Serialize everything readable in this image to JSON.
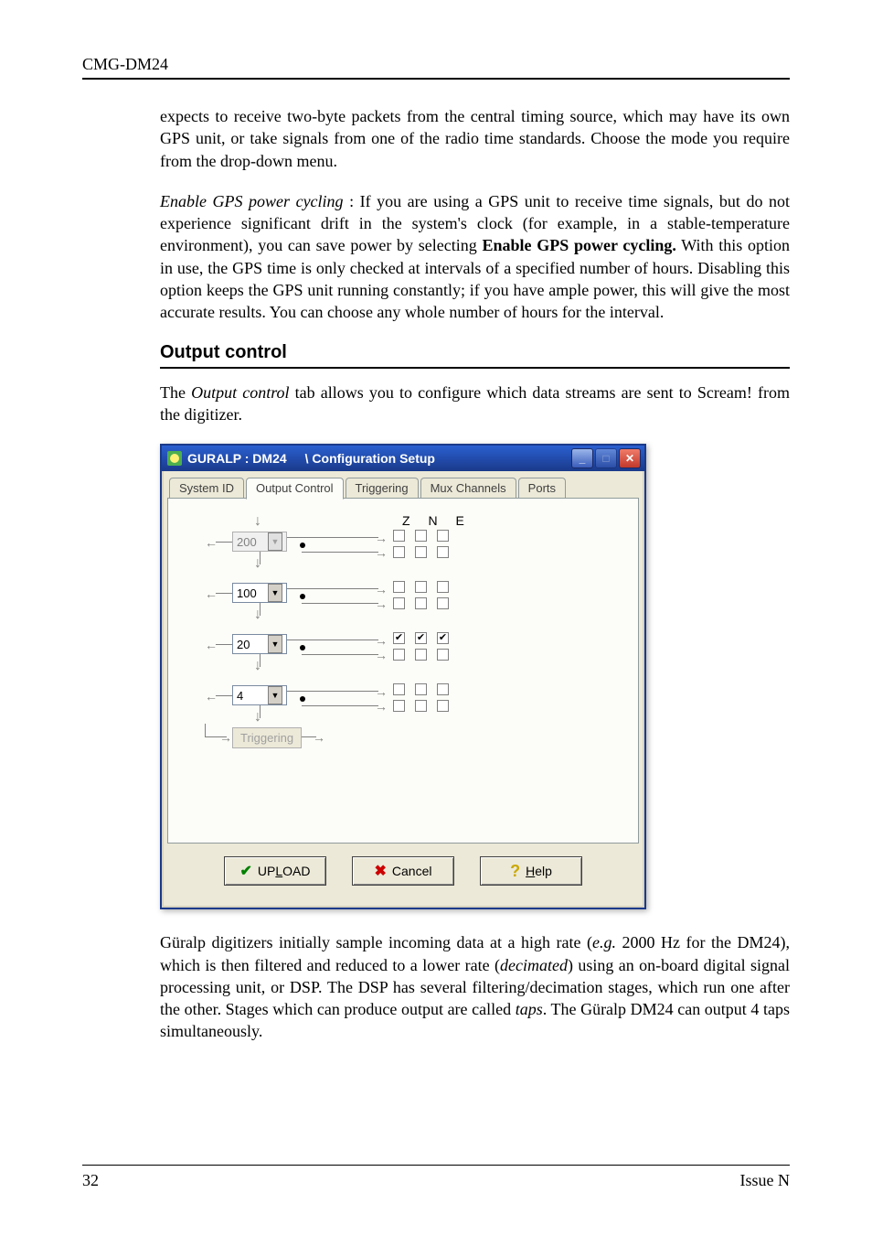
{
  "header": {
    "left": "CMG-DM24",
    "right": ""
  },
  "para1": "expects to receive two-byte packets from the central timing source, which may have its own GPS unit, or take signals from one of the radio time standards. Choose the mode you require from the drop-down menu.",
  "para2_prefix_italic": "Enable GPS power cycling",
  "para2_body": " : If you are using a GPS unit to receive time signals, but do not experience significant drift in the system's clock (for example, in a stable-temperature environment), you can save power by selecting ",
  "para2_bold": "Enable GPS power cycling.",
  "para2_tail": " With this option in use, the GPS time is only checked at intervals of a specified number of hours. Disabling this option keeps the GPS unit running constantly; if you have ample power, this will give the most accurate results. You can choose any whole number of hours for the interval.",
  "section_title": "Output control",
  "para3_a": "The ",
  "para3_italic": "Output control",
  "para3_b": " tab allows you to configure which data streams are sent to Scream! from the digitizer.",
  "dialog": {
    "title_left": "GURALP : DM24",
    "title_right": "\\ Configuration Setup",
    "tabs": [
      "System ID",
      "Output Control",
      "Triggering",
      "Mux Channels",
      "Ports"
    ],
    "active_tab_index": 1,
    "zne": "Z  N  E",
    "rates": [
      "200",
      "100",
      "20",
      "4"
    ],
    "trig_label": "Triggering",
    "buttons": {
      "upload": "UPLOAD",
      "cancel": "Cancel",
      "help": "Help"
    },
    "upload_ul": "L",
    "help_ul": "H"
  },
  "para4_a": "Güralp digitizers initially sample incoming data at a high rate (",
  "para4_eg": "e.g.",
  "para4_b": " 2000 Hz for the DM24), which is then filtered and reduced to a lower rate (",
  "para4_dec": "decimated",
  "para4_c": ") using an on-board digital signal processing unit, or DSP. The DSP has several filtering/decimation stages, which run one after the other. Stages which can produce output are called ",
  "para4_taps": "taps",
  "para4_d": ". The Güralp DM24 can output 4 taps simultaneously.",
  "footer": {
    "left": "32",
    "right": "Issue N"
  }
}
